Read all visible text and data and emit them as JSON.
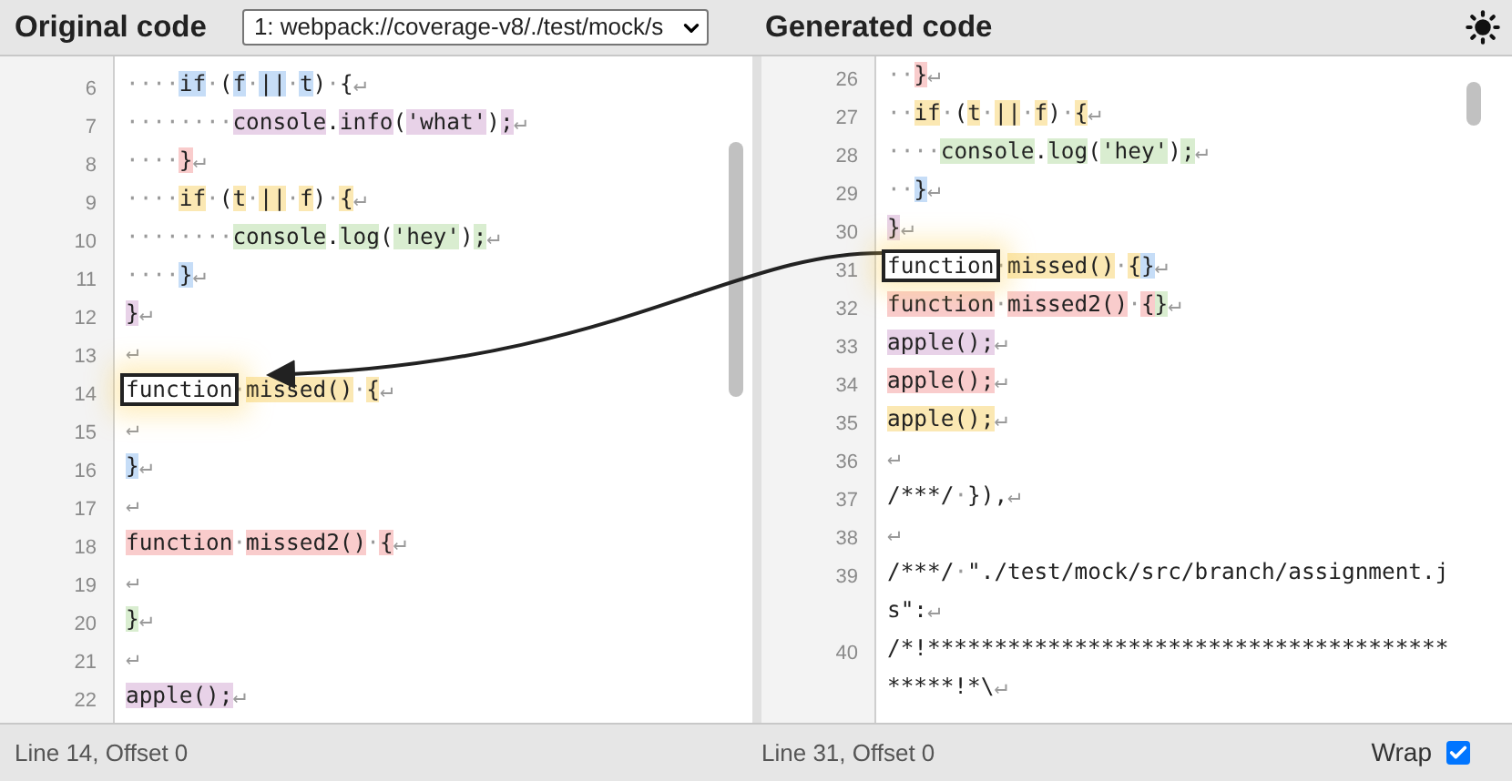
{
  "left_pane": {
    "title": "Original code",
    "source_select": {
      "value": "1: webpack://coverage-v8/./test/mock/s"
    },
    "lines": [
      {
        "number": "6",
        "segments": [
          {
            "text": "····",
            "kind": "whitespace"
          },
          {
            "text": "if",
            "color": "#c6ddf7"
          },
          {
            "text": "·",
            "kind": "whitespace"
          },
          {
            "text": "("
          },
          {
            "text": "f",
            "color": "#c6ddf7"
          },
          {
            "text": "·",
            "kind": "whitespace"
          },
          {
            "text": "||",
            "color": "#c6ddf7"
          },
          {
            "text": "·",
            "kind": "whitespace"
          },
          {
            "text": "t",
            "color": "#c6ddf7"
          },
          {
            "text": ")"
          },
          {
            "text": "·",
            "kind": "whitespace"
          },
          {
            "text": "{"
          },
          {
            "text": "↵",
            "kind": "whitespace"
          }
        ]
      },
      {
        "number": "7",
        "segments": [
          {
            "text": "········",
            "kind": "whitespace"
          },
          {
            "text": "console",
            "color": "#e8d2e8"
          },
          {
            "text": "."
          },
          {
            "text": "info",
            "color": "#e8d2e8"
          },
          {
            "text": "("
          },
          {
            "text": "'what'",
            "color": "#e8d2e8"
          },
          {
            "text": ")"
          },
          {
            "text": ";",
            "color": "#e8d2e8"
          },
          {
            "text": "↵",
            "kind": "whitespace"
          }
        ]
      },
      {
        "number": "8",
        "segments": [
          {
            "text": "····",
            "kind": "whitespace"
          },
          {
            "text": "}",
            "color": "#f9cccc"
          },
          {
            "text": "↵",
            "kind": "whitespace"
          }
        ]
      },
      {
        "number": "9",
        "segments": [
          {
            "text": "····",
            "kind": "whitespace"
          },
          {
            "text": "if",
            "color": "#fbe8b3"
          },
          {
            "text": "·",
            "kind": "whitespace"
          },
          {
            "text": "("
          },
          {
            "text": "t",
            "color": "#fbe8b3"
          },
          {
            "text": "·",
            "kind": "whitespace"
          },
          {
            "text": "||",
            "color": "#fbe8b3"
          },
          {
            "text": "·",
            "kind": "whitespace"
          },
          {
            "text": "f",
            "color": "#fbe8b3"
          },
          {
            "text": ")"
          },
          {
            "text": "·",
            "kind": "whitespace"
          },
          {
            "text": "{",
            "color": "#fbe8b3"
          },
          {
            "text": "↵",
            "kind": "whitespace"
          }
        ]
      },
      {
        "number": "10",
        "segments": [
          {
            "text": "········",
            "kind": "whitespace"
          },
          {
            "text": "console",
            "color": "#d9edd0"
          },
          {
            "text": "."
          },
          {
            "text": "log",
            "color": "#d9edd0"
          },
          {
            "text": "("
          },
          {
            "text": "'hey'",
            "color": "#d9edd0"
          },
          {
            "text": ")"
          },
          {
            "text": ";",
            "color": "#d9edd0"
          },
          {
            "text": "↵",
            "kind": "whitespace"
          }
        ]
      },
      {
        "number": "11",
        "segments": [
          {
            "text": "····",
            "kind": "whitespace"
          },
          {
            "text": "}",
            "color": "#c6ddf7"
          },
          {
            "text": "↵",
            "kind": "whitespace"
          }
        ]
      },
      {
        "number": "12",
        "segments": [
          {
            "text": "}",
            "color": "#e8d2e8"
          },
          {
            "text": "↵",
            "kind": "whitespace"
          }
        ]
      },
      {
        "number": "13",
        "segments": [
          {
            "text": "↵",
            "kind": "whitespace"
          }
        ]
      },
      {
        "number": "14",
        "segments": [
          {
            "text": "function",
            "boxed": true
          },
          {
            "text": "·",
            "kind": "whitespace"
          },
          {
            "text": "missed",
            "color": "#fbe8b3"
          },
          {
            "text": "()",
            "color": "#fbe8b3"
          },
          {
            "text": "·",
            "kind": "whitespace"
          },
          {
            "text": "{",
            "color": "#fbe8b3"
          },
          {
            "text": "↵",
            "kind": "whitespace"
          }
        ]
      },
      {
        "number": "15",
        "segments": [
          {
            "text": "↵",
            "kind": "whitespace"
          }
        ]
      },
      {
        "number": "16",
        "segments": [
          {
            "text": "}",
            "color": "#c6ddf7"
          },
          {
            "text": "↵",
            "kind": "whitespace"
          }
        ]
      },
      {
        "number": "17",
        "segments": [
          {
            "text": "↵",
            "kind": "whitespace"
          }
        ]
      },
      {
        "number": "18",
        "segments": [
          {
            "text": "function",
            "color": "#f9cccc"
          },
          {
            "text": "·",
            "kind": "whitespace"
          },
          {
            "text": "missed2",
            "color": "#f9cccc"
          },
          {
            "text": "()",
            "color": "#f9cccc"
          },
          {
            "text": "·",
            "kind": "whitespace"
          },
          {
            "text": "{",
            "color": "#f9cccc"
          },
          {
            "text": "↵",
            "kind": "whitespace"
          }
        ]
      },
      {
        "number": "19",
        "segments": [
          {
            "text": "↵",
            "kind": "whitespace"
          }
        ]
      },
      {
        "number": "20",
        "segments": [
          {
            "text": "}",
            "color": "#d9edd0"
          },
          {
            "text": "↵",
            "kind": "whitespace"
          }
        ]
      },
      {
        "number": "21",
        "segments": [
          {
            "text": "↵",
            "kind": "whitespace"
          }
        ]
      },
      {
        "number": "22",
        "segments": [
          {
            "text": "apple",
            "color": "#e8d2e8"
          },
          {
            "text": "(",
            "color": "#e8d2e8"
          },
          {
            "text": ")",
            "color": "#e8d2e8"
          },
          {
            "text": ";",
            "color": "#e8d2e8"
          },
          {
            "text": "↵",
            "kind": "whitespace"
          }
        ]
      }
    ],
    "status": "Line 14, Offset 0"
  },
  "right_pane": {
    "title": "Generated code",
    "lines": [
      {
        "number": "26",
        "segments": [
          {
            "text": "··",
            "kind": "whitespace"
          },
          {
            "text": "}",
            "color": "#f9cccc"
          },
          {
            "text": "↵",
            "kind": "whitespace"
          }
        ]
      },
      {
        "number": "27",
        "segments": [
          {
            "text": "··",
            "kind": "whitespace"
          },
          {
            "text": "if",
            "color": "#fbe8b3"
          },
          {
            "text": "·",
            "kind": "whitespace"
          },
          {
            "text": "("
          },
          {
            "text": "t",
            "color": "#fbe8b3"
          },
          {
            "text": "·",
            "kind": "whitespace"
          },
          {
            "text": "||",
            "color": "#fbe8b3"
          },
          {
            "text": "·",
            "kind": "whitespace"
          },
          {
            "text": "f",
            "color": "#fbe8b3"
          },
          {
            "text": ")"
          },
          {
            "text": "·",
            "kind": "whitespace"
          },
          {
            "text": "{",
            "color": "#fbe8b3"
          },
          {
            "text": "↵",
            "kind": "whitespace"
          }
        ]
      },
      {
        "number": "28",
        "segments": [
          {
            "text": "····",
            "kind": "whitespace"
          },
          {
            "text": "console",
            "color": "#d9edd0"
          },
          {
            "text": "."
          },
          {
            "text": "log",
            "color": "#d9edd0"
          },
          {
            "text": "("
          },
          {
            "text": "'hey'",
            "color": "#d9edd0"
          },
          {
            "text": ")"
          },
          {
            "text": ";",
            "color": "#d9edd0"
          },
          {
            "text": "↵",
            "kind": "whitespace"
          }
        ]
      },
      {
        "number": "29",
        "segments": [
          {
            "text": "··",
            "kind": "whitespace"
          },
          {
            "text": "}",
            "color": "#c6ddf7"
          },
          {
            "text": "↵",
            "kind": "whitespace"
          }
        ]
      },
      {
        "number": "30",
        "segments": [
          {
            "text": "}",
            "color": "#e8d2e8"
          },
          {
            "text": "↵",
            "kind": "whitespace"
          }
        ]
      },
      {
        "number": "31",
        "segments": [
          {
            "text": "function",
            "boxed": true
          },
          {
            "text": "·",
            "kind": "whitespace"
          },
          {
            "text": "missed",
            "color": "#fbe8b3"
          },
          {
            "text": "()",
            "color": "#fbe8b3"
          },
          {
            "text": "·",
            "kind": "whitespace"
          },
          {
            "text": "{",
            "color": "#fbe8b3"
          },
          {
            "text": "}",
            "color": "#c6ddf7"
          },
          {
            "text": "↵",
            "kind": "whitespace"
          }
        ]
      },
      {
        "number": "32",
        "segments": [
          {
            "text": "function",
            "color": "#f9cccc"
          },
          {
            "text": "·",
            "kind": "whitespace"
          },
          {
            "text": "missed2",
            "color": "#f9cccc"
          },
          {
            "text": "()",
            "color": "#f9cccc"
          },
          {
            "text": "·",
            "kind": "whitespace"
          },
          {
            "text": "{",
            "color": "#f9cccc"
          },
          {
            "text": "}",
            "color": "#d9edd0"
          },
          {
            "text": "↵",
            "kind": "whitespace"
          }
        ]
      },
      {
        "number": "33",
        "segments": [
          {
            "text": "apple",
            "color": "#e8d2e8"
          },
          {
            "text": "()",
            "color": "#e8d2e8"
          },
          {
            "text": ";",
            "color": "#e8d2e8"
          },
          {
            "text": "↵",
            "kind": "whitespace"
          }
        ]
      },
      {
        "number": "34",
        "segments": [
          {
            "text": "apple",
            "color": "#f9cccc"
          },
          {
            "text": "()",
            "color": "#f9cccc"
          },
          {
            "text": ";",
            "color": "#f9cccc"
          },
          {
            "text": "↵",
            "kind": "whitespace"
          }
        ]
      },
      {
        "number": "35",
        "segments": [
          {
            "text": "apple",
            "color": "#fbe8b3"
          },
          {
            "text": "()",
            "color": "#fbe8b3"
          },
          {
            "text": ";",
            "color": "#fbe8b3"
          },
          {
            "text": "↵",
            "kind": "whitespace"
          }
        ]
      },
      {
        "number": "36",
        "segments": [
          {
            "text": "↵",
            "kind": "whitespace"
          }
        ]
      },
      {
        "number": "37",
        "segments": [
          {
            "text": "/***/"
          },
          {
            "text": "·",
            "kind": "whitespace"
          },
          {
            "text": "}),"
          },
          {
            "text": "↵",
            "kind": "whitespace"
          }
        ]
      },
      {
        "number": "38",
        "segments": [
          {
            "text": "↵",
            "kind": "whitespace"
          }
        ]
      },
      {
        "number": "39",
        "segments": [
          {
            "text": "/***/"
          },
          {
            "text": "·",
            "kind": "whitespace"
          },
          {
            "text": "\"./test/mock/src/branch/assignment.js\":"
          },
          {
            "text": "↵",
            "kind": "whitespace"
          }
        ]
      },
      {
        "number": "40",
        "segments": [
          {
            "text": "/*!********************************************!*\\"
          },
          {
            "text": "↵",
            "kind": "whitespace"
          }
        ]
      }
    ],
    "status": "Line 31, Offset 0",
    "wrap": {
      "label": "Wrap",
      "checked": true
    }
  }
}
